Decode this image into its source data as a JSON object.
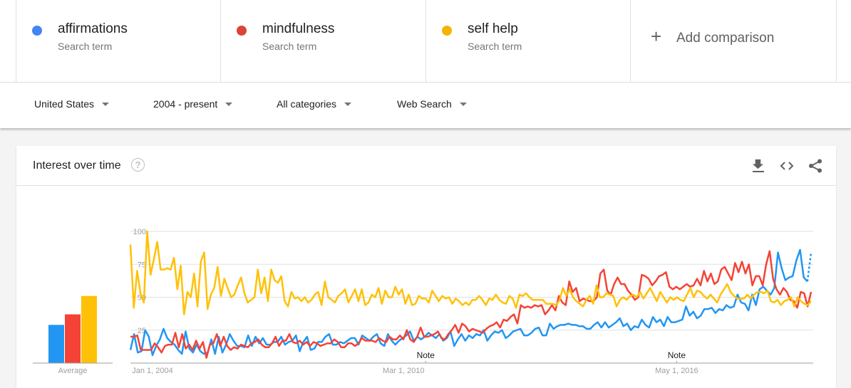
{
  "terms": [
    {
      "name": "affirmations",
      "sub": "Search term",
      "color": "#4285f4"
    },
    {
      "name": "mindfulness",
      "sub": "Search term",
      "color": "#db4437"
    },
    {
      "name": "self help",
      "sub": "Search term",
      "color": "#f4b400"
    }
  ],
  "add_comparison": {
    "icon": "plus-icon",
    "label": "Add comparison"
  },
  "filters": [
    {
      "label": "United States"
    },
    {
      "label": "2004 - present"
    },
    {
      "label": "All categories"
    },
    {
      "label": "Web Search"
    }
  ],
  "card": {
    "title": "Interest over time",
    "help_icon": "?",
    "icons": [
      "download-icon",
      "embed-code-icon",
      "share-icon"
    ]
  },
  "chart_data": {
    "type": "line",
    "title": "Interest over time",
    "ylim": [
      0,
      100
    ],
    "yticks": [
      25,
      50,
      75,
      100
    ],
    "xticks": [
      "Jan 1, 2004",
      "Mar 1, 2010",
      "May 1, 2016"
    ],
    "notes": [
      {
        "label": "Note",
        "at": "2010-09"
      },
      {
        "label": "Note",
        "at": "2016-05"
      }
    ],
    "x_start": "2004-01",
    "x_end": "2019-06",
    "frequency": "monthly",
    "average": {
      "label": "Average",
      "values": {
        "affirmations": 29,
        "mindfulness": 37,
        "self help": 51
      }
    },
    "series": [
      {
        "name": "affirmations",
        "color": "#2196f3",
        "values": [
          10,
          22,
          8,
          9,
          25,
          20,
          6,
          13,
          18,
          26,
          19,
          16,
          14,
          10,
          7,
          24,
          11,
          8,
          14,
          9,
          7,
          8,
          18,
          7,
          20,
          8,
          14,
          22,
          17,
          13,
          13,
          12,
          21,
          13,
          20,
          15,
          19,
          14,
          14,
          16,
          16,
          20,
          14,
          16,
          17,
          21,
          9,
          16,
          20,
          10,
          11,
          16,
          16,
          20,
          22,
          14,
          14,
          16,
          15,
          17,
          19,
          19,
          14,
          21,
          19,
          17,
          20,
          22,
          15,
          13,
          22,
          17,
          14,
          17,
          19,
          21,
          24,
          17,
          20,
          18,
          20,
          23,
          21,
          19,
          22,
          17,
          19,
          24,
          13,
          18,
          22,
          17,
          21,
          19,
          22,
          21,
          25,
          17,
          21,
          24,
          23,
          25,
          19,
          21,
          24,
          25,
          26,
          21,
          21,
          23,
          26,
          27,
          21,
          21,
          30,
          26,
          28,
          29,
          29,
          30,
          29,
          29,
          28,
          28,
          26,
          26,
          29,
          31,
          27,
          31,
          27,
          29,
          31,
          34,
          28,
          30,
          25,
          28,
          27,
          33,
          29,
          27,
          35,
          31,
          33,
          28,
          35,
          31,
          31,
          32,
          33,
          43,
          36,
          39,
          34,
          36,
          41,
          41,
          42,
          38,
          41,
          40,
          44,
          42,
          43,
          52,
          46,
          45,
          40,
          52,
          44,
          56,
          58,
          55,
          52,
          57,
          84,
          72,
          63,
          65,
          66,
          78,
          86,
          65,
          62,
          84
        ],
        "dotted_last": true
      },
      {
        "name": "mindfulness",
        "color": "#f44336",
        "values": [
          20,
          20,
          21,
          10,
          10,
          10,
          10,
          15,
          12,
          8,
          13,
          14,
          14,
          23,
          12,
          22,
          11,
          14,
          10,
          17,
          11,
          16,
          4,
          14,
          15,
          22,
          13,
          20,
          13,
          10,
          12,
          11,
          14,
          13,
          12,
          15,
          16,
          18,
          14,
          12,
          12,
          15,
          20,
          13,
          17,
          17,
          22,
          16,
          15,
          17,
          14,
          16,
          13,
          16,
          15,
          13,
          14,
          15,
          15,
          18,
          16,
          12,
          12,
          15,
          15,
          13,
          15,
          19,
          17,
          17,
          17,
          16,
          19,
          17,
          16,
          20,
          18,
          18,
          21,
          18,
          25,
          18,
          16,
          20,
          27,
          20,
          20,
          21,
          22,
          24,
          19,
          18,
          22,
          25,
          29,
          23,
          30,
          28,
          24,
          26,
          25,
          24,
          23,
          26,
          28,
          29,
          31,
          27,
          33,
          32,
          35,
          37,
          30,
          44,
          42,
          43,
          42,
          44,
          43,
          44,
          37,
          40,
          44,
          40,
          51,
          46,
          44,
          62,
          54,
          57,
          47,
          49,
          48,
          47,
          47,
          50,
          68,
          71,
          55,
          52,
          60,
          65,
          60,
          60,
          55,
          52,
          48,
          50,
          67,
          66,
          64,
          59,
          62,
          66,
          67,
          69,
          58,
          56,
          58,
          56,
          58,
          60,
          58,
          59,
          64,
          59,
          70,
          62,
          68,
          60,
          62,
          71,
          73,
          68,
          63,
          76,
          69,
          77,
          68,
          75,
          59,
          66,
          66,
          59,
          75,
          85,
          64,
          56,
          52,
          57,
          54,
          48,
          47,
          42,
          54,
          53,
          43,
          54
        ]
      },
      {
        "name": "self help",
        "color": "#ffc107",
        "values": [
          90,
          42,
          70,
          53,
          46,
          100,
          67,
          79,
          92,
          71,
          71,
          72,
          71,
          80,
          56,
          74,
          37,
          54,
          50,
          68,
          43,
          77,
          84,
          41,
          52,
          57,
          73,
          51,
          64,
          57,
          50,
          52,
          59,
          65,
          53,
          46,
          48,
          50,
          71,
          53,
          65,
          47,
          71,
          63,
          61,
          66,
          47,
          43,
          54,
          49,
          50,
          47,
          50,
          46,
          48,
          52,
          54,
          44,
          62,
          50,
          48,
          46,
          51,
          53,
          56,
          46,
          51,
          56,
          47,
          56,
          44,
          46,
          52,
          50,
          57,
          45,
          55,
          50,
          50,
          58,
          52,
          56,
          45,
          52,
          44,
          45,
          51,
          49,
          49,
          46,
          55,
          51,
          47,
          51,
          49,
          50,
          45,
          49,
          47,
          44,
          46,
          44,
          48,
          48,
          51,
          48,
          44,
          49,
          48,
          52,
          48,
          46,
          45,
          51,
          49,
          42,
          52,
          51,
          53,
          50,
          48,
          48,
          48,
          48,
          45,
          45,
          45,
          44,
          48,
          57,
          51,
          56,
          50,
          47,
          45,
          43,
          48,
          51,
          45,
          59,
          50,
          50,
          53,
          52,
          51,
          43,
          48,
          50,
          48,
          51,
          52,
          50,
          54,
          49,
          53,
          57,
          52,
          47,
          54,
          50,
          46,
          50,
          48,
          50,
          48,
          47,
          52,
          57,
          50,
          55,
          54,
          51,
          49,
          52,
          49,
          46,
          52,
          56,
          60,
          54,
          51,
          49,
          49,
          49,
          52,
          49,
          52,
          54,
          54,
          53,
          55,
          47,
          46,
          48,
          44,
          47,
          48,
          50,
          43,
          50,
          47,
          45,
          44,
          47
        ]
      }
    ]
  }
}
